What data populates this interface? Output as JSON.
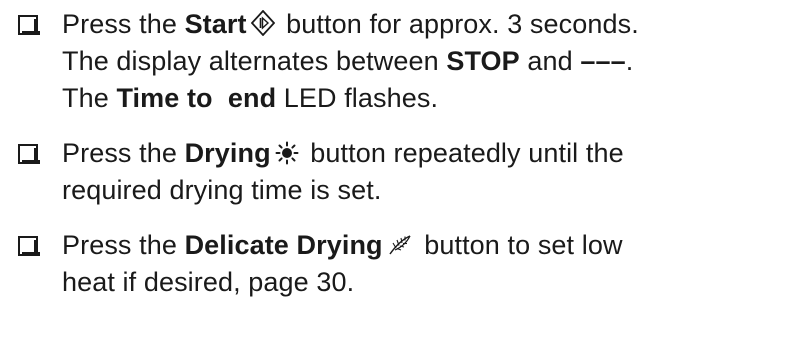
{
  "steps": [
    {
      "lines": [
        [
          "Press the ",
          "Start",
          " button for approx. 3 seconds."
        ],
        [
          "The display alternates between ",
          "STOP",
          " and ",
          "–––",
          "."
        ],
        [
          "The ",
          "Time to  end",
          " LED flashes."
        ]
      ],
      "icon": "start-pause-diamond-icon"
    },
    {
      "lines": [
        [
          "Press the ",
          "Drying",
          " button repeatedly until the"
        ],
        [
          "required drying time is set."
        ]
      ],
      "icon": "sun-drying-icon"
    },
    {
      "lines": [
        [
          "Press the ",
          "Delicate Drying",
          " button to set low"
        ],
        [
          "heat if desired, page 30."
        ]
      ],
      "icon": "feather-delicate-icon"
    }
  ]
}
